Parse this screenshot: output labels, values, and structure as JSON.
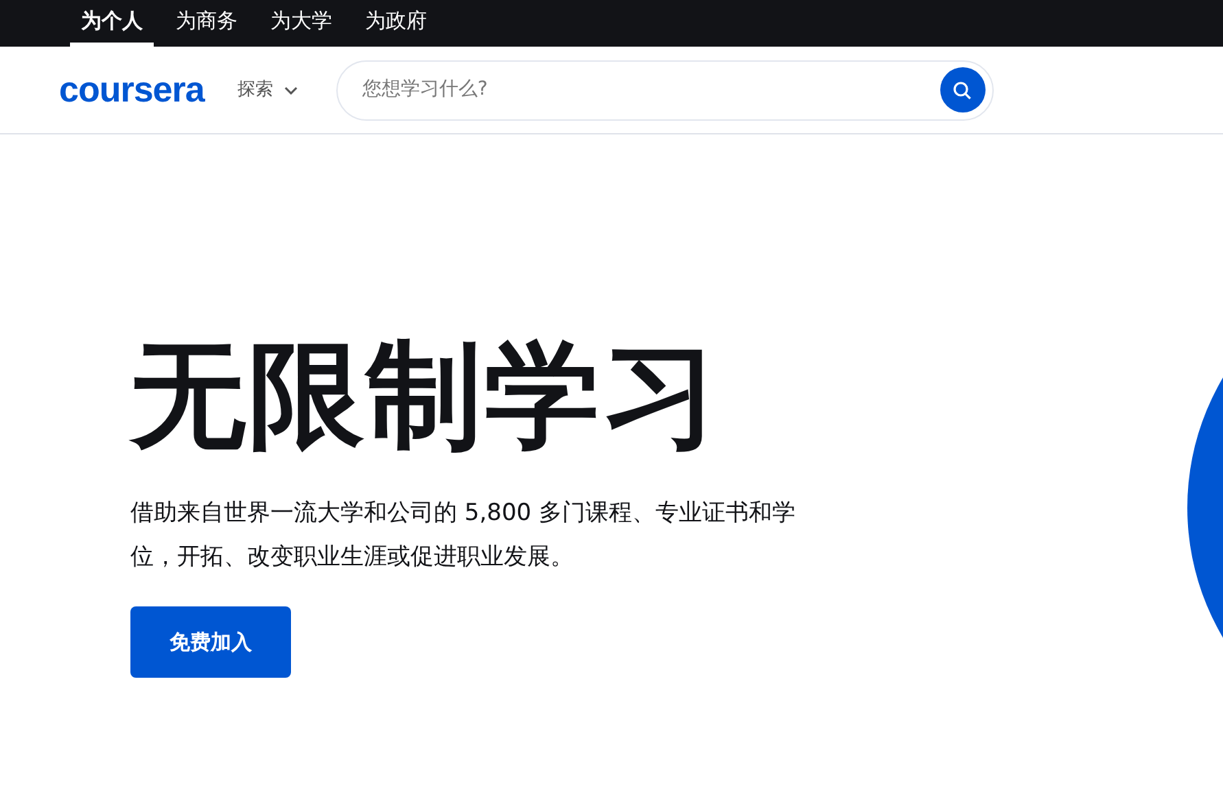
{
  "audience_tabs": [
    {
      "label": "为个人",
      "selected": true
    },
    {
      "label": "为商务",
      "selected": false
    },
    {
      "label": "为大学",
      "selected": false
    },
    {
      "label": "为政府",
      "selected": false
    }
  ],
  "header": {
    "logo": "coursera",
    "explore": "探索",
    "search": {
      "placeholder": "您想学习什么?"
    }
  },
  "hero": {
    "title": "无限制学习",
    "description": "借助来自世界一流大学和公司的 5,800 多门课程、专业证书和学位，开拓、改变职业生涯或促进职业发展。",
    "button": "免费加入"
  }
}
